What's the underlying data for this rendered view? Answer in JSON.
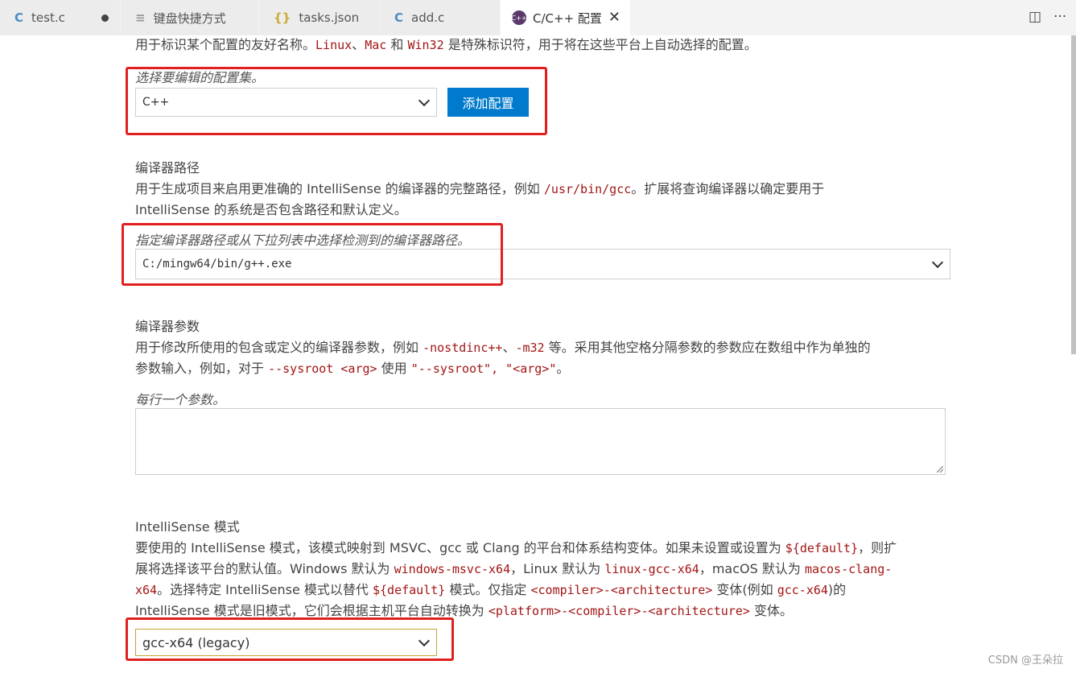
{
  "tabs": [
    {
      "icon": "C",
      "label": "test.c",
      "status": "●"
    },
    {
      "icon": "≡",
      "label": "键盘快捷方式"
    },
    {
      "icon": "{}",
      "label": "tasks.json"
    },
    {
      "icon": "C",
      "label": "add.c"
    },
    {
      "icon": "C++",
      "label": "C/C++ 配置",
      "close": "✕"
    }
  ],
  "toolbar": {
    "split_icon": "◫",
    "more_icon": "···"
  },
  "config_name": {
    "desc_parts": [
      "用于标识某个配置的友好名称。",
      "Linux",
      "、",
      "Mac",
      " 和 ",
      "Win32",
      " 是特殊标识符，用于将在这些平台上自动选择的配置。"
    ],
    "hint": "选择要编辑的配置集。",
    "selected": "C++",
    "add_button": "添加配置"
  },
  "compiler_path": {
    "title": "编译器路径",
    "desc1_parts": [
      "用于生成项目来启用更准确的 IntelliSense 的编译器的完整路径，例如 ",
      "/usr/bin/gcc",
      "。扩展将查询编译器以确定要用于"
    ],
    "desc2": "IntelliSense 的系统是否包含路径和默认定义。",
    "hint": "指定编译器路径或从下拉列表中选择检测到的编译器路径。",
    "value": "C:/mingw64/bin/g++.exe"
  },
  "compiler_args": {
    "title": "编译器参数",
    "desc1_parts": [
      "用于修改所使用的包含或定义的编译器参数，例如 ",
      "-nostdinc++",
      "、",
      "-m32",
      " 等。采用其他空格分隔参数的参数应在数组中作为单独的"
    ],
    "desc2_parts": [
      "参数输入，例如，对于 ",
      "--sysroot <arg>",
      " 使用 ",
      "\"--sysroot\", \"<arg>\"",
      "。"
    ],
    "hint": "每行一个参数。",
    "value": ""
  },
  "intellisense_mode": {
    "title": "IntelliSense 模式",
    "line1_parts": [
      "要使用的 IntelliSense 模式，该模式映射到 MSVC、gcc 或 Clang 的平台和体系结构变体。如果未设置或设置为 ",
      "${default}",
      "，则扩"
    ],
    "line2_parts": [
      "展将选择该平台的默认值。Windows 默认为 ",
      "windows-msvc-x64",
      "，Linux 默认为 ",
      "linux-gcc-x64",
      "，macOS 默认为 ",
      "macos-clang-"
    ],
    "line3_parts": [
      "x64",
      "。选择特定 IntelliSense 模式以替代 ",
      "${default}",
      " 模式。仅指定 ",
      "<compiler>-<architecture>",
      " 变体(例如 ",
      "gcc-x64",
      ")的"
    ],
    "line4_parts": [
      "IntelliSense 模式是旧模式，它们会根据主机平台自动转换为 ",
      "<platform>-<compiler>-<architecture>",
      " 变体。"
    ],
    "selected": "gcc-x64 (legacy)"
  },
  "watermark": "CSDN @王朵拉",
  "colors": {
    "accent": "#007acc",
    "highlight_box": "#e02020",
    "code": "#a31515"
  }
}
